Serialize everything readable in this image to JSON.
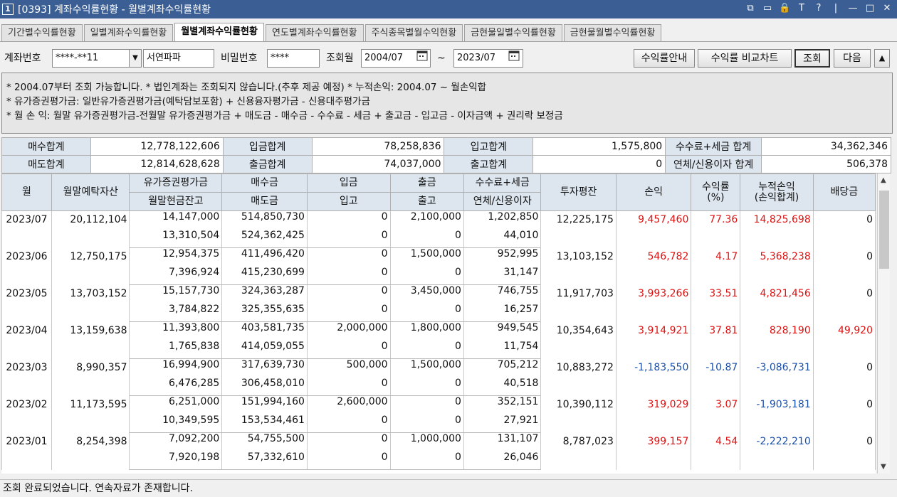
{
  "window": {
    "number": "1",
    "title": "[0393] 계좌수익률현황 - 월별계좌수익률현황",
    "controls": [
      "⧉",
      "▭",
      "🔒",
      "T",
      "?",
      "|",
      "—",
      "□",
      "✕"
    ]
  },
  "tabs": [
    "기간별수익률현황",
    "일별계좌수익률현황",
    "월별계좌수익률현황",
    "연도별계좌수익률현황",
    "주식종목별월수익현황",
    "금현물일별수익률현황",
    "금현물월별수익률현황"
  ],
  "active_tab_index": 2,
  "query": {
    "account_label": "계좌번호",
    "account_value": "****-**11",
    "account_name": "서연파파",
    "password_label": "비밀번호",
    "password_value": "****",
    "month_label": "조회월",
    "from": "2004/07",
    "tilde": "~",
    "to": "2023/07",
    "btn_guide": "수익률안내",
    "btn_chart": "수익률 비교차트",
    "btn_search": "조회",
    "btn_next": "다음",
    "btn_up": "▲"
  },
  "notes": [
    "* 2004.07부터 조회 가능합니다.   * 법인계좌는 조회되지 않습니다.(추후 제공 예정)   * 누적손익: 2004.07 ~ 월손익합",
    "* 유가증권평가금: 일반유가증권평가금(예탁담보포함) + 신용융자평가금 - 신용대주평가금",
    "* 월 손 익: 월말 유가증권평가금-전월말 유가증권평가금 + 매도금 - 매수금 - 수수료 - 세금 + 출고금 - 입고금 - 이자금액 + 권리락 보정금"
  ],
  "summary": [
    [
      "매수합계",
      "12,778,122,606",
      "입금합계",
      "78,258,836",
      "입고합계",
      "1,575,800",
      "수수료+세금 합계",
      "34,362,346"
    ],
    [
      "매도합계",
      "12,814,628,628",
      "출금합계",
      "74,037,000",
      "출고합계",
      "0",
      "연체/신용이자 합계",
      "506,378"
    ]
  ],
  "headers": {
    "month": "월",
    "deposit_assets": "월말예탁자산",
    "sec_eval": "유가증권평가금",
    "cash_bal": "월말현금잔고",
    "buy": "매수금",
    "sell": "매도금",
    "deposit": "입금",
    "stock_in": "입고",
    "withdraw": "출금",
    "stock_out": "출고",
    "fee_tax": "수수료+세금",
    "overdue_int": "연체/신용이자",
    "avg_inv": "투자평잔",
    "pnl": "손익",
    "ret1": "수익률",
    "ret2": "(%)",
    "cum1": "누적손익",
    "cum2": "(손익합계)",
    "dividend": "배당금"
  },
  "rows": [
    {
      "month": "2023/07",
      "assets": "20,112,104",
      "sec": "14,147,000",
      "cash": "13,310,504",
      "buy": "514,850,730",
      "sell": "524,362,425",
      "dep": "0",
      "sin": "0",
      "wd": "2,100,000",
      "sout": "0",
      "fee": "1,202,850",
      "int": "44,010",
      "avg": "12,225,175",
      "pnl": "9,457,460",
      "ret": "77.36",
      "cum": "14,825,698",
      "div": "0",
      "pnl_color": "red",
      "cum_color": "red",
      "div_color": ""
    },
    {
      "month": "2023/06",
      "assets": "12,750,175",
      "sec": "12,954,375",
      "cash": "7,396,924",
      "buy": "411,496,420",
      "sell": "415,230,699",
      "dep": "0",
      "sin": "0",
      "wd": "1,500,000",
      "sout": "0",
      "fee": "952,995",
      "int": "31,147",
      "avg": "13,103,152",
      "pnl": "546,782",
      "ret": "4.17",
      "cum": "5,368,238",
      "div": "0",
      "pnl_color": "red",
      "cum_color": "red",
      "div_color": ""
    },
    {
      "month": "2023/05",
      "assets": "13,703,152",
      "sec": "15,157,730",
      "cash": "3,784,822",
      "buy": "324,363,287",
      "sell": "325,355,635",
      "dep": "0",
      "sin": "0",
      "wd": "3,450,000",
      "sout": "0",
      "fee": "746,755",
      "int": "16,257",
      "avg": "11,917,703",
      "pnl": "3,993,266",
      "ret": "33.51",
      "cum": "4,821,456",
      "div": "0",
      "pnl_color": "red",
      "cum_color": "red",
      "div_color": ""
    },
    {
      "month": "2023/04",
      "assets": "13,159,638",
      "sec": "11,393,800",
      "cash": "1,765,838",
      "buy": "403,581,735",
      "sell": "414,059,055",
      "dep": "2,000,000",
      "sin": "0",
      "wd": "1,800,000",
      "sout": "0",
      "fee": "949,545",
      "int": "11,754",
      "avg": "10,354,643",
      "pnl": "3,914,921",
      "ret": "37.81",
      "cum": "828,190",
      "div": "49,920",
      "pnl_color": "red",
      "cum_color": "red",
      "div_color": "red"
    },
    {
      "month": "2023/03",
      "assets": "8,990,357",
      "sec": "16,994,900",
      "cash": "6,476,285",
      "buy": "317,639,730",
      "sell": "306,458,010",
      "dep": "500,000",
      "sin": "0",
      "wd": "1,500,000",
      "sout": "0",
      "fee": "705,212",
      "int": "40,518",
      "avg": "10,883,272",
      "pnl": "-1,183,550",
      "ret": "-10.87",
      "cum": "-3,086,731",
      "div": "0",
      "pnl_color": "blue",
      "cum_color": "blue",
      "div_color": ""
    },
    {
      "month": "2023/02",
      "assets": "11,173,595",
      "sec": "6,251,000",
      "cash": "10,349,595",
      "buy": "151,994,160",
      "sell": "153,534,461",
      "dep": "2,600,000",
      "sin": "0",
      "wd": "0",
      "sout": "0",
      "fee": "352,151",
      "int": "27,921",
      "avg": "10,390,112",
      "pnl": "319,029",
      "ret": "3.07",
      "cum": "-1,903,181",
      "div": "0",
      "pnl_color": "red",
      "cum_color": "blue",
      "div_color": ""
    },
    {
      "month": "2023/01",
      "assets": "8,254,398",
      "sec": "7,092,200",
      "cash": "7,920,198",
      "buy": "54,755,500",
      "sell": "57,332,610",
      "dep": "0",
      "sin": "0",
      "wd": "1,000,000",
      "sout": "0",
      "fee": "131,107",
      "int": "26,046",
      "avg": "8,787,023",
      "pnl": "399,157",
      "ret": "4.54",
      "cum": "-2,222,210",
      "div": "0",
      "pnl_color": "red",
      "cum_color": "blue",
      "div_color": ""
    }
  ],
  "status": "조회 완료되었습니다. 연속자료가 존재합니다."
}
